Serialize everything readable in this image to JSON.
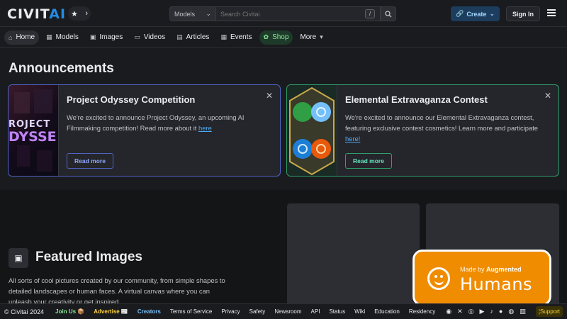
{
  "header": {
    "logo": {
      "text_a": "CIVIT",
      "text_b": "AI"
    },
    "search": {
      "select_value": "Models",
      "placeholder": "Search Civitai",
      "shortcut": "/"
    },
    "create_label": "Create",
    "signin_label": "Sign In"
  },
  "nav": [
    {
      "label": "Home",
      "icon": "home-icon",
      "glyph": "⌂"
    },
    {
      "label": "Models",
      "icon": "models-icon",
      "glyph": "▦"
    },
    {
      "label": "Images",
      "icon": "image-icon",
      "glyph": "▣"
    },
    {
      "label": "Videos",
      "icon": "video-icon",
      "glyph": "▭"
    },
    {
      "label": "Articles",
      "icon": "article-icon",
      "glyph": "▤"
    },
    {
      "label": "Events",
      "icon": "calendar-icon",
      "glyph": "▦"
    },
    {
      "label": "Shop",
      "icon": "shop-icon",
      "glyph": "✿"
    },
    {
      "label": "More",
      "icon": "chevron-down-icon",
      "glyph": "▾"
    }
  ],
  "announcements": {
    "title": "Announcements",
    "cards": [
      {
        "title": "Project Odyssey Competition",
        "body": "We're excited to announce Project Odyssey, an upcoming AI Filmmaking competition! Read more about it ",
        "link": "here",
        "button": "Read more",
        "image_text_a": "ROJECT",
        "image_text_b": "DYSSE"
      },
      {
        "title": "Elemental Extravaganza Contest",
        "body": "We're excited to announce our Elemental Extravaganza contest, featuring exclusive contest cosmetics! Learn more and participate ",
        "link": "here!",
        "button": "Read more"
      }
    ]
  },
  "featured": {
    "title": "Featured Images",
    "description": "All sorts of cool pictures created by our community, from simple shapes to detailed landscapes or human faces. A virtual canvas where you can unleash your creativity or get inspired."
  },
  "badge": {
    "made_by": "Made by",
    "augmented": "Augmented",
    "humans": "Humans"
  },
  "footer": {
    "copyright": "© Civitai 2024",
    "join": "Join Us 📦",
    "advertise": "Advertise 📰",
    "creators": "Creators",
    "links": [
      "Terms of Service",
      "Privacy",
      "Safety",
      "Newsroom",
      "API",
      "Status",
      "Wiki",
      "Education",
      "Residency"
    ],
    "support": "Support"
  }
}
